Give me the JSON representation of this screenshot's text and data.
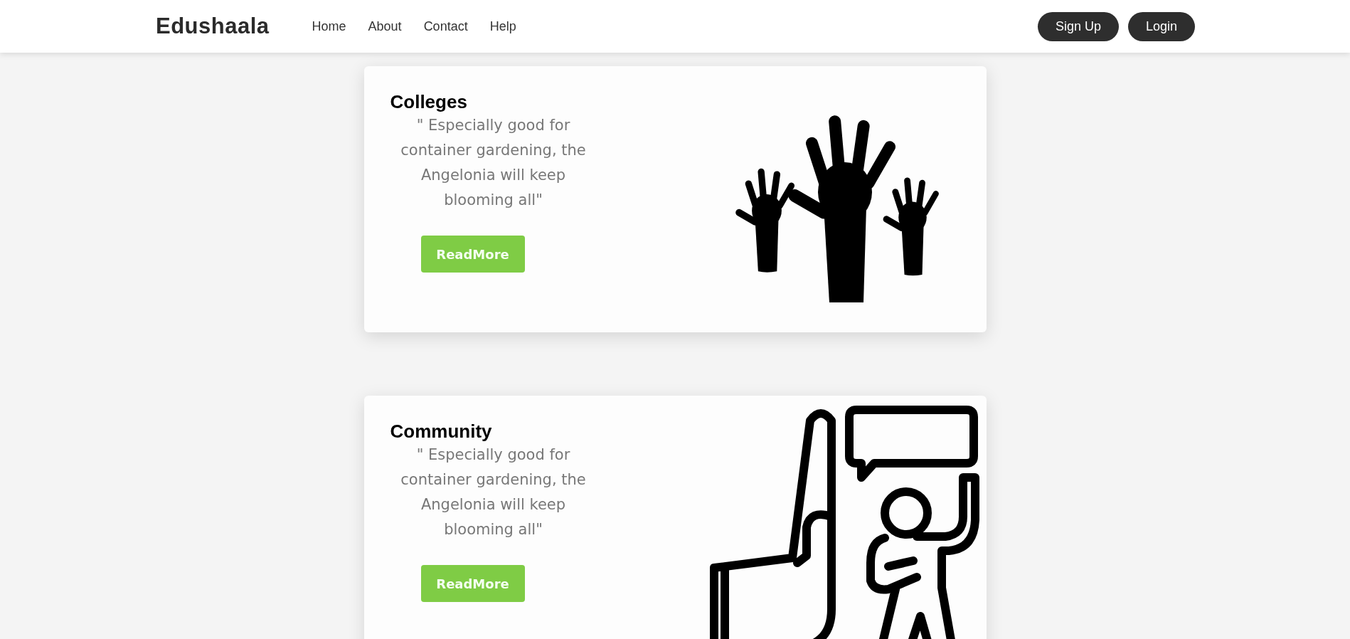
{
  "header": {
    "brand": "Edushaala",
    "nav": [
      "Home",
      "About",
      "Contact",
      "Help"
    ],
    "auth_buttons": [
      "Sign Up",
      "Login"
    ]
  },
  "cards": [
    {
      "kind": "hands",
      "title": "Colleges",
      "text": "\" Especially good for container gardening, the Angelonia will keep blooming all\"",
      "button": "ReadMore"
    },
    {
      "kind": "community",
      "title": "Community",
      "text": "\" Especially good for container gardening, the Angelonia will keep blooming all\"",
      "button": "ReadMore"
    }
  ]
}
